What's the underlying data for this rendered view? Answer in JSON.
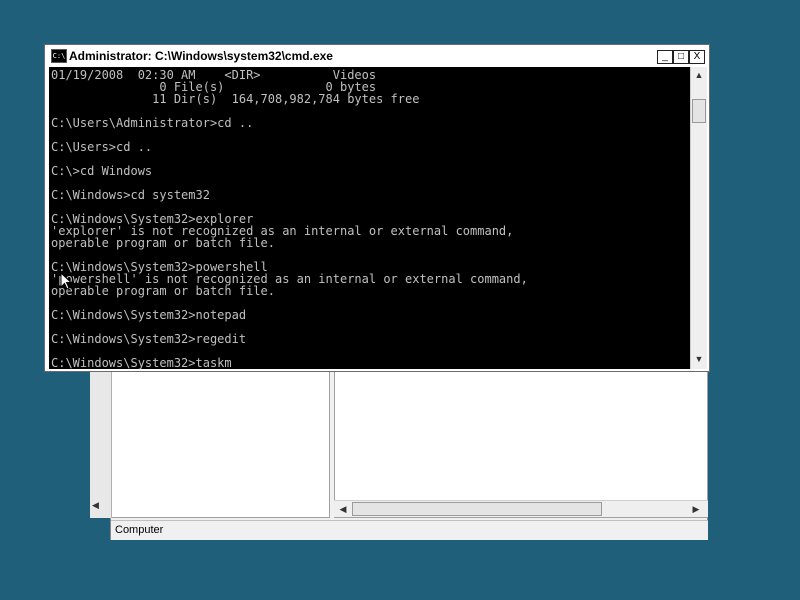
{
  "cmd_window": {
    "title": "Administrator: C:\\Windows\\system32\\cmd.exe",
    "icon_label": "C:\\",
    "minimize_glyph": "_",
    "maximize_glyph": "□",
    "close_glyph": "X",
    "console_lines": [
      "01/19/2008  02:30 AM    <DIR>          Videos",
      "               0 File(s)              0 bytes",
      "              11 Dir(s)  164,708,982,784 bytes free",
      "",
      "C:\\Users\\Administrator>cd ..",
      "",
      "C:\\Users>cd ..",
      "",
      "C:\\>cd Windows",
      "",
      "C:\\Windows>cd system32",
      "",
      "C:\\Windows\\System32>explorer",
      "'explorer' is not recognized as an internal or external command,",
      "operable program or batch file.",
      "",
      "C:\\Windows\\System32>powershell",
      "'powershell' is not recognized as an internal or external command,",
      "operable program or batch file.",
      "",
      "C:\\Windows\\System32>notepad",
      "",
      "C:\\Windows\\System32>regedit",
      "",
      "C:\\Windows\\System32>taskm"
    ],
    "scroll_up_glyph": "▲",
    "scroll_down_glyph": "▼"
  },
  "background_window": {
    "status_text": "Computer",
    "scroll_left_glyph": "◀",
    "scroll_right_glyph": "▶"
  },
  "colors": {
    "desktop": "#1f5f7a",
    "console_bg": "#000000",
    "console_fg": "#c0c0c0"
  }
}
